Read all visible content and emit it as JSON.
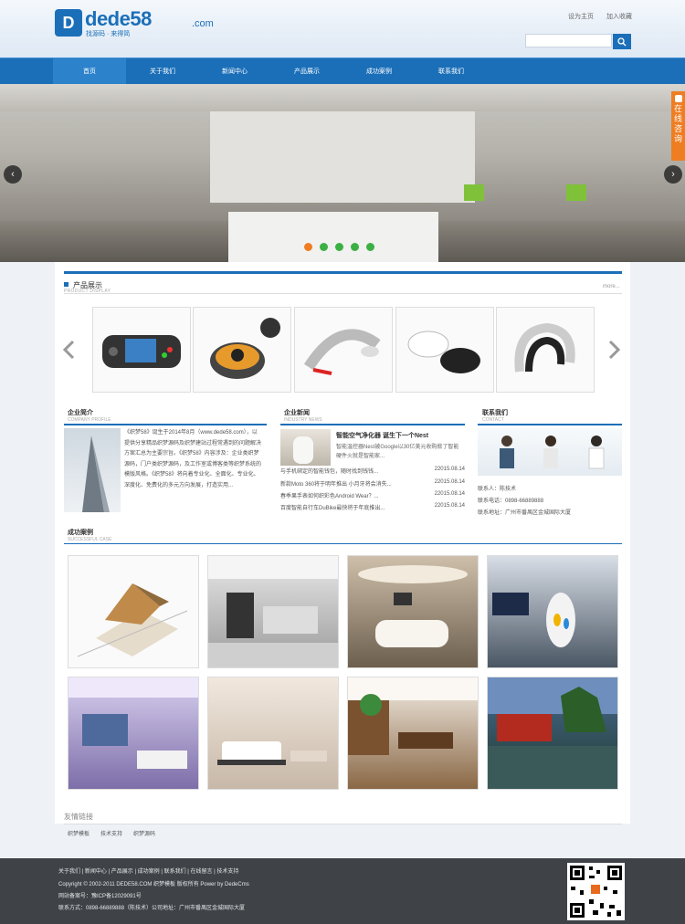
{
  "header": {
    "logo_word": "dede58",
    "logo_com": ".com",
    "logo_slogan": "找源码 · 来得简",
    "top_links": [
      "设为主页",
      "加入收藏"
    ],
    "search_placeholder": ""
  },
  "nav": [
    "首页",
    "关于我们",
    "新闻中心",
    "产品展示",
    "成功案例",
    "联系我们"
  ],
  "banner": {
    "float_tab": "在线咨询",
    "prev": "‹",
    "next": "›",
    "slide_count": 5
  },
  "products": {
    "title": "产品展示",
    "subtitle": "PRODUCT DISPLAY",
    "more": "more..."
  },
  "about": {
    "title": "企业简介",
    "subtitle": "COMPANY PROFILE",
    "text": "《织梦58》诞生于2014年8月（www.dede58.com），以提供分享精品织梦源码及织梦建站过程常遇到的问题解决方案汇总为主要宗旨。《织梦58》内容涉及：企业类织梦源码，门户类织梦源码，及工作室或博客类等织梦系统的模版风格。《织梦58》将向着专业化、全面化、专业化、深度化、免费化的多元方向发展，打造实用..."
  },
  "news": {
    "title": "企业新闻",
    "subtitle": "INDUSTRY NEWS",
    "headline": "智能空气净化器 诞生下一个Nest",
    "summary": "智能温控器Nest被Google以30亿美元收购掀了智能硬件火就是智能家...",
    "items": [
      {
        "text": "与手机绑定的智能钱包，随时找到钱钱...",
        "date": "22015.08.14"
      },
      {
        "text": "新款Moto 360将于明年推出 小月牙将会消失...",
        "date": "22015.08.14"
      },
      {
        "text": "春季果手表如何织彩色Android Wear？...",
        "date": "22015.08.14"
      },
      {
        "text": "百度智能自行车DuBike最快将于年底推出...",
        "date": "22015.08.14"
      }
    ]
  },
  "contact": {
    "title": "联系我们",
    "subtitle": "CONTACT",
    "lines": [
      "联系人：陈技术",
      "联系电话：0898-66889888",
      "联系地址：广州市番禺区金城国际大厦"
    ]
  },
  "cases": {
    "title": "成功案例",
    "subtitle": "SUCCESSFUL CASE"
  },
  "friend_links": {
    "title": "友情链接",
    "items": [
      "织梦模板",
      "技术支持",
      "织梦源码"
    ]
  },
  "footer": {
    "links": "关于我们 | 新闻中心 | 产品展示 | 成功案例 | 联系我们 | 在线留言 | 技术支持",
    "copyright": "Copyright © 2002-2011 DEDE58.COM 织梦模板 版权所有 Power by DedeCms",
    "icp": "网站备案号：豫ICP备12029091号",
    "contact": "联系方式：0898-66889888（陈技术）公司地址：广州市番禺区金城国际大厦"
  }
}
